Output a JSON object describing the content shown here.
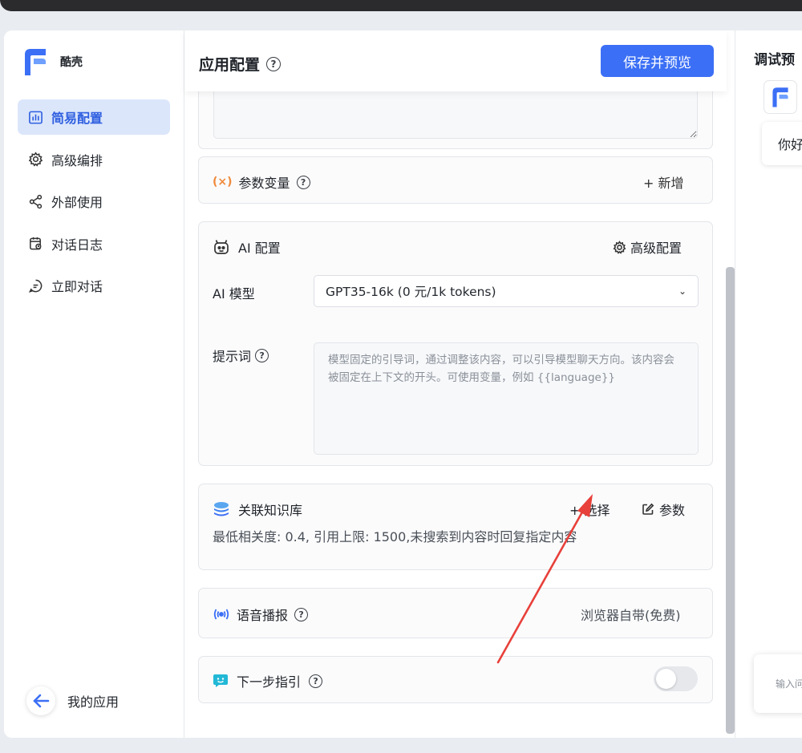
{
  "brand": {
    "name": "酷壳"
  },
  "sidebar": {
    "items": [
      {
        "label": "简易配置",
        "icon": "bar-chart-icon"
      },
      {
        "label": "高级编排",
        "icon": "gear-icon"
      },
      {
        "label": "外部使用",
        "icon": "share-icon"
      },
      {
        "label": "对话日志",
        "icon": "calendar-log-icon"
      },
      {
        "label": "立即对话",
        "icon": "chat-bubble-icon"
      }
    ],
    "back_label": "我的应用"
  },
  "header": {
    "title": "应用配置",
    "save_label": "保存并预览"
  },
  "variables": {
    "label": "参数变量",
    "add_label": "+ 新增"
  },
  "ai_config": {
    "title": "AI 配置",
    "advanced_label": "高级配置",
    "model_label": "AI 模型",
    "model_value": "GPT35-16k (0 元/1k tokens)",
    "prompt_label": "提示词",
    "prompt_placeholder": "模型固定的引导词，通过调整该内容，可以引导模型聊天方向。该内容会被固定在上下文的开头。可使用变量，例如 {{language}}"
  },
  "knowledge": {
    "title": "关联知识库",
    "select_label": "+ 选择",
    "params_label": "参数",
    "summary": "最低相关度: 0.4, 引用上限: 1500,未搜索到内容时回复指定内容"
  },
  "tts": {
    "label": "语音播报",
    "value": "浏览器自带(免费)"
  },
  "next_step": {
    "label": "下一步指引",
    "enabled": false
  },
  "preview": {
    "title": "调试预",
    "greeting": "你好",
    "input_placeholder": "输入问"
  },
  "colors": {
    "accent": "#3b6ff5",
    "active_bg": "#dbe6fb",
    "annotation_arrow": "#e8403a"
  }
}
